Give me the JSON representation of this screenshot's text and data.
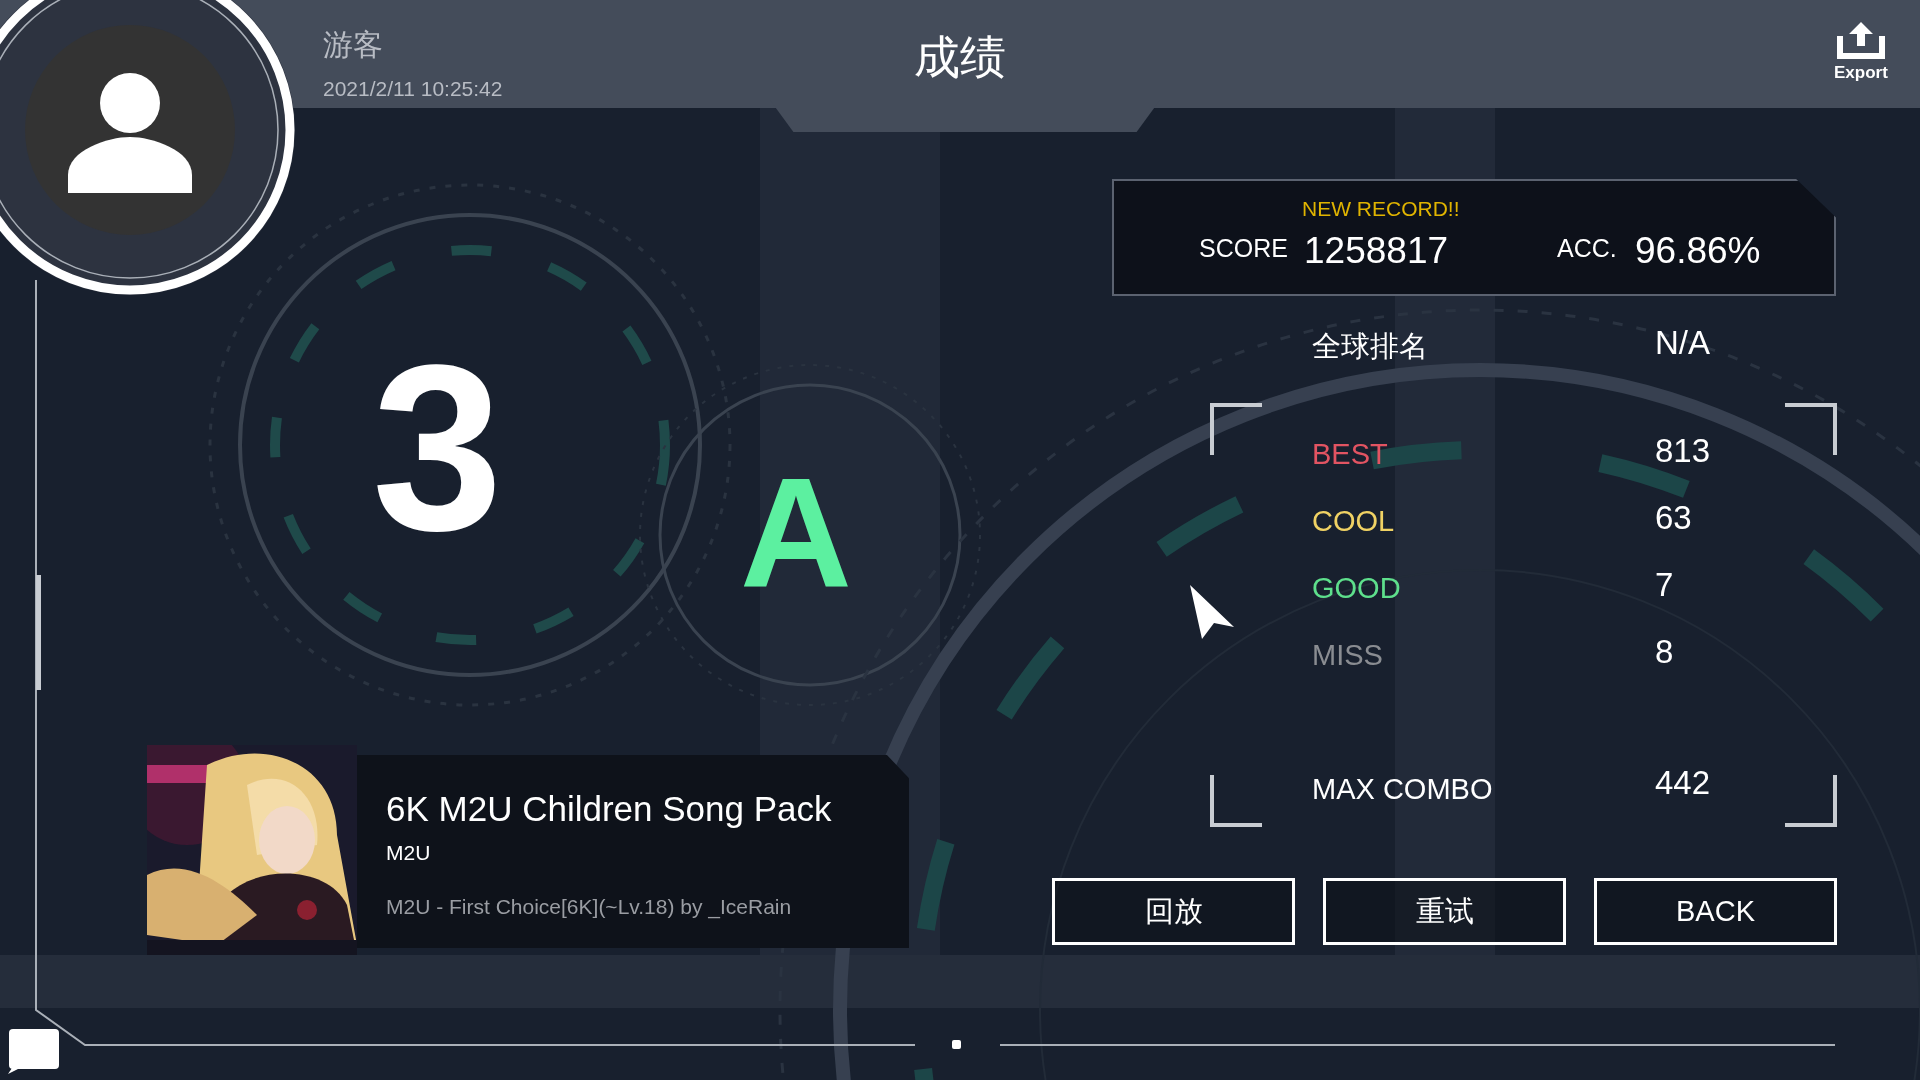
{
  "header": {
    "username": "游客",
    "timestamp": "2021/2/11 10:25:42",
    "title": "成绩",
    "export_label": "Export"
  },
  "rank": {
    "count": "3",
    "grade": "A"
  },
  "score_panel": {
    "badge": "NEW RECORD!!",
    "score_label": "SCORE",
    "score": "1258817",
    "acc_label": "ACC.",
    "acc": "96.86%"
  },
  "global_rank": {
    "label": "全球排名",
    "value": "N/A"
  },
  "judgements": [
    {
      "label": "BEST",
      "value": "813",
      "color": "#e25462"
    },
    {
      "label": "COOL",
      "value": "63",
      "color": "#f0d264"
    },
    {
      "label": "GOOD",
      "value": "7",
      "color": "#5ee08c"
    },
    {
      "label": "MISS",
      "value": "8",
      "color": "#8a8d92"
    }
  ],
  "max_combo": {
    "label": "MAX COMBO",
    "value": "442"
  },
  "song": {
    "title": "6K M2U Children Song Pack",
    "artist": "M2U",
    "chart": "M2U - First Choice[6K](~Lv.18) by _IceRain"
  },
  "buttons": [
    "回放",
    "重试",
    "BACK"
  ]
}
